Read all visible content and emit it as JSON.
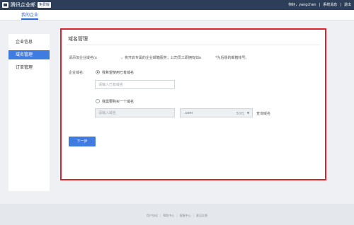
{
  "header": {
    "brand": "腾讯企业邮",
    "badge": "免费版",
    "user_greeting": "你好，yangchen",
    "system_messages": "系统消息",
    "logout": "退出",
    "separator": "|"
  },
  "subnav": {
    "tab": "我的企业"
  },
  "sidebar": {
    "items": [
      {
        "label": "企业信息"
      },
      {
        "label": "域名管理"
      },
      {
        "label": "订单管理"
      }
    ]
  },
  "panel": {
    "title": "域名管理",
    "intro_part1": "请添加企业域名(x",
    "intro_part2": "，将开启专属的企业邮箱服务；公司员工即拥有如a",
    "intro_part3": "*为后缀的邮箱帐号。",
    "field_label": "企业域名:",
    "option_existing": "我希望使用已有域名",
    "existing_placeholder": "请输入已有域名",
    "option_buy": "我需要购买一个域名",
    "buy_placeholder": "请输入域名",
    "suffix": ".com",
    "price": "50元",
    "caret": "▼",
    "query": "查询域名",
    "next_button": "下一步"
  },
  "footer": {
    "links": [
      "用户协议",
      "帮助中心",
      "客服中心",
      "意见反馈"
    ]
  },
  "colors": {
    "topbar": "#2c3e58",
    "accent": "#3f7ce2",
    "highlight_border": "#d8262f"
  }
}
